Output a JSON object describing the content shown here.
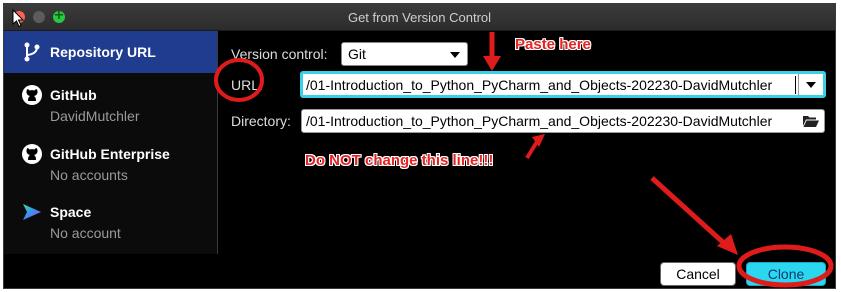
{
  "window": {
    "title": "Get from Version Control"
  },
  "sidebar": {
    "items": [
      {
        "label": "Repository URL",
        "sub": "",
        "icon": "vcs-branch-icon",
        "selected": true
      },
      {
        "label": "GitHub",
        "sub": "DavidMutchler",
        "icon": "github-icon",
        "selected": false
      },
      {
        "label": "GitHub Enterprise",
        "sub": "No accounts",
        "icon": "github-icon",
        "selected": false
      },
      {
        "label": "Space",
        "sub": "No account",
        "icon": "space-icon",
        "selected": false
      }
    ]
  },
  "form": {
    "vcs_label": "Version control:",
    "vcs_value": "Git",
    "url_label": "URL:",
    "url_value": "/01-Introduction_to_Python_PyCharm_and_Objects-202230-DavidMutchler",
    "dir_label": "Directory:",
    "dir_value": "/01-Introduction_to_Python_PyCharm_and_Objects-202230-DavidMutchler"
  },
  "buttons": {
    "cancel": "Cancel",
    "clone": "Clone"
  },
  "annotations": {
    "paste_here": "Paste here",
    "do_not_change": "Do NOT change this line!!!"
  },
  "colors": {
    "selection": "#1f3c8f",
    "url_focus": "#3ad0e8",
    "clone_button": "#2ad7ef",
    "annotation_red": "#e52323"
  }
}
